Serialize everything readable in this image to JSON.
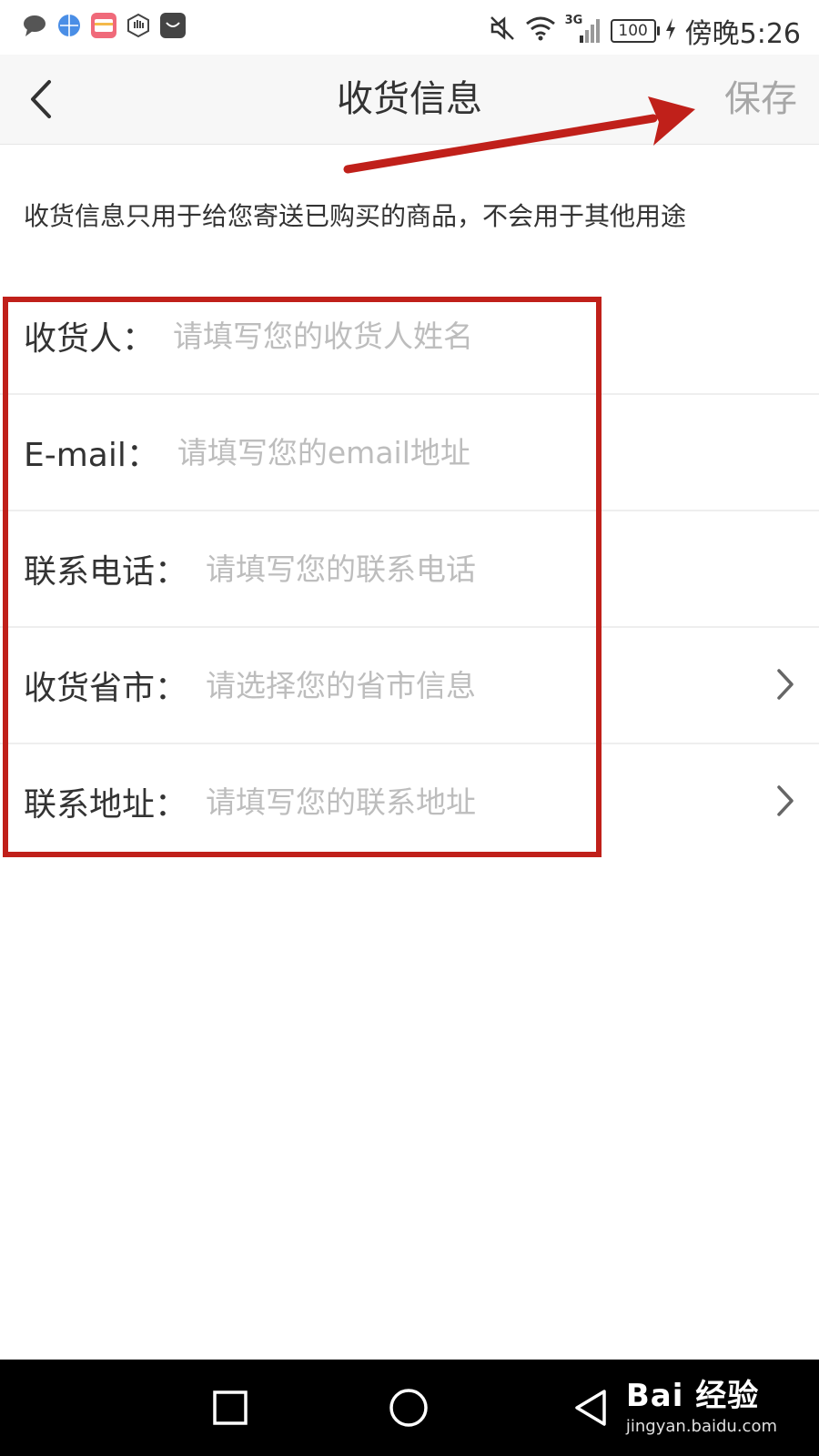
{
  "status_bar": {
    "battery": "100",
    "network": "3G",
    "carrier_time": "傍晚5:26"
  },
  "header": {
    "title": "收货信息",
    "save_label": "保存"
  },
  "notice": "收货信息只用于给您寄送已购买的商品，不会用于其他用途",
  "form": {
    "fields": [
      {
        "label": "收货人：",
        "placeholder": "请填写您的收货人姓名"
      },
      {
        "label": "E-mail：",
        "placeholder": "请填写您的email地址"
      },
      {
        "label": "联系电话：",
        "placeholder": "请填写您的联系电话"
      },
      {
        "label": "收货省市：",
        "placeholder": "请选择您的省市信息"
      },
      {
        "label": "联系地址：",
        "placeholder": "请填写您的联系地址"
      }
    ]
  },
  "watermark": {
    "brand": "Bai 经验",
    "url": "jingyan.baidu.com"
  },
  "colors": {
    "annotation_red": "#c0201a",
    "placeholder_gray": "#bdbdbd",
    "save_gray": "#a7a7a7"
  }
}
